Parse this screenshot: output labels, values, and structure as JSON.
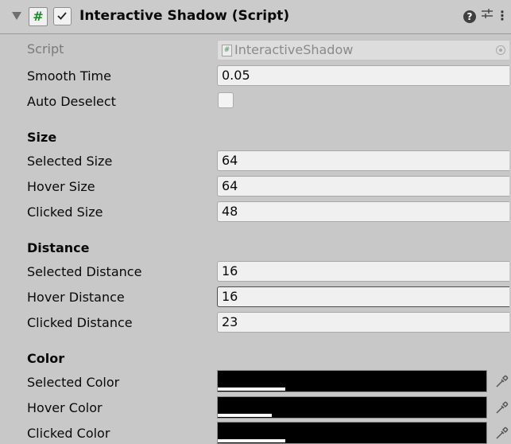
{
  "component": {
    "title": "Interactive Shadow (Script)",
    "script_icon_glyph": "#",
    "enabled": true,
    "help_icon": "help-icon",
    "presets_icon": "presets-icon",
    "more_icon": "kebab-menu-icon"
  },
  "fields": {
    "script": {
      "label": "Script",
      "value": "InteractiveShadow"
    },
    "smooth_time": {
      "label": "Smooth Time",
      "value": "0.05"
    },
    "auto_deselect": {
      "label": "Auto Deselect",
      "checked": false
    }
  },
  "sections": {
    "size": {
      "header": "Size",
      "selected": {
        "label": "Selected Size",
        "value": "64"
      },
      "hover": {
        "label": "Hover Size",
        "value": "64"
      },
      "clicked": {
        "label": "Clicked Size",
        "value": "48"
      }
    },
    "distance": {
      "header": "Distance",
      "selected": {
        "label": "Selected Distance",
        "value": "16"
      },
      "hover": {
        "label": "Hover Distance",
        "value": "16"
      },
      "clicked": {
        "label": "Clicked Distance",
        "value": "23"
      }
    },
    "color": {
      "header": "Color",
      "selected": {
        "label": "Selected Color",
        "color": "#000000",
        "alpha": 0.25
      },
      "hover": {
        "label": "Hover Color",
        "color": "#000000",
        "alpha": 0.2
      },
      "clicked": {
        "label": "Clicked Color",
        "color": "#000000",
        "alpha": 0.25
      }
    }
  }
}
